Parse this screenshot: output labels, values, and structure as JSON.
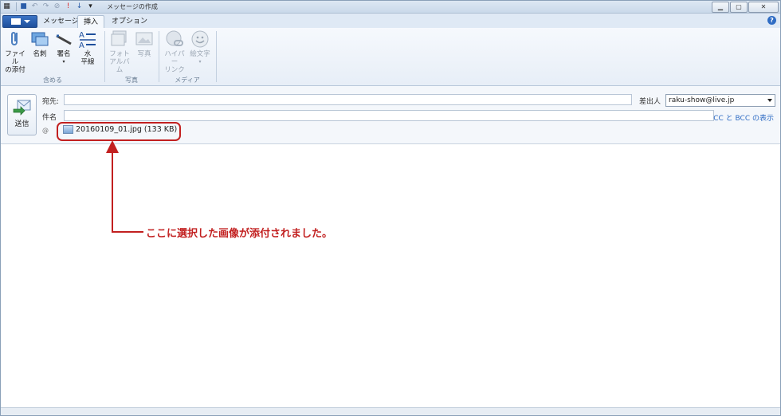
{
  "window": {
    "title": "メッセージの作成"
  },
  "tabs": [
    {
      "label": "メッセージ"
    },
    {
      "label": "挿入"
    },
    {
      "label": "オプション"
    }
  ],
  "ribbon": {
    "groups": [
      {
        "label": "含める",
        "buttons": [
          "ファイル\nの添付",
          "名刺",
          "署名",
          "水\n平線"
        ]
      },
      {
        "label": "写真",
        "buttons": [
          "フォト\nアルバム",
          "写真"
        ]
      },
      {
        "label": "メディア",
        "buttons": [
          "ハイパー\nリンク",
          "絵文字"
        ]
      }
    ]
  },
  "compose": {
    "send_label": "送信",
    "to_label": "宛先:",
    "subject_label": "件名",
    "from_label": "差出人",
    "from_value": "raku-show@live.jp",
    "cc_link": "CC と BCC の表示",
    "attach_symbol": "@",
    "attachment": "20160109_01.jpg (133 KB)"
  },
  "annotation": {
    "text": "ここに選択した画像が添付されました。"
  },
  "colors": {
    "accent": "#2f6cc4",
    "annotation": "#c22020"
  }
}
